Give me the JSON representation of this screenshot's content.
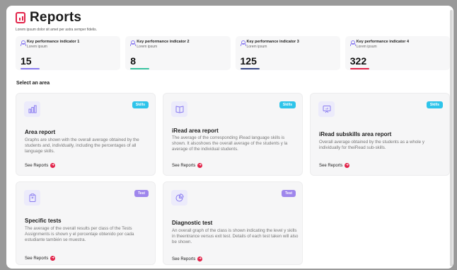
{
  "header": {
    "title": "Reports",
    "subtitle": "Lorem ipsum dolor sit amet per astra semper fidelis."
  },
  "kpis": [
    {
      "title": "Key performance indicator 1",
      "subtitle": "Lorem ipsum",
      "value": "15",
      "bar_color": "#8a7cf0"
    },
    {
      "title": "Key performance indicator 2",
      "subtitle": "Lorem ipsum",
      "value": "8",
      "bar_color": "#39c3a0"
    },
    {
      "title": "Key performance indicator 3",
      "subtitle": "Lorem ipsum",
      "value": "125",
      "bar_color": "#3a4a8a"
    },
    {
      "title": "Key performance indicator 4",
      "subtitle": "Lorem ipsum",
      "value": "322",
      "bar_color": "#e2244a"
    }
  ],
  "section_title": "Select an area",
  "cards": [
    {
      "icon": "bar-chart-icon",
      "badge": "Skills",
      "title": "Area report",
      "description": "Graphs are shown with the overall average obtained by the students and, individually, including the percentages of all language skills.",
      "link": "See Reports"
    },
    {
      "icon": "open-book-icon",
      "badge": "Skills",
      "title": "iRead area report",
      "description": "The average of the corresponding iRead language skills is shown. It alsoshows the overall average of the students y la average of the individual students.",
      "link": "See Reports"
    },
    {
      "icon": "presentation-board-icon",
      "badge": "Skills",
      "title": "iRead subskills area report",
      "description": "Overall average obtained by the students as a whole y individually for theiRead sub-skills.",
      "link": "See Reports"
    },
    {
      "icon": "clipboard-icon",
      "badge": "Test",
      "title": "Specific tests",
      "description": "The average of the overall results per class of the Tests Assignments is shown y el porcentaje obtenido por cada estudiante también se muestra.",
      "link": "See Reports"
    },
    {
      "icon": "pie-chart-icon",
      "badge": "Test",
      "title": "Diagnostic test",
      "description": "An overall graph of the class is shown indicating the level y skills in theentrance versus exit test. Details of each test taken will also be shown.",
      "link": "See Reports"
    }
  ],
  "colors": {
    "accent": "#e2244a",
    "skills_badge": "#2ec4ea",
    "test_badge": "#9f86ec",
    "icon_purple": "#8a7cf0"
  },
  "link_arrow": "➜"
}
